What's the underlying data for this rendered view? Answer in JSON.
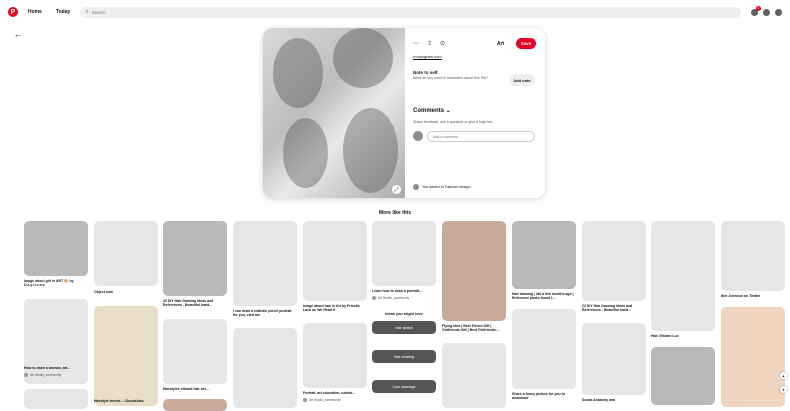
{
  "topbar": {
    "logo": "P",
    "home": "Home",
    "today": "Today",
    "search_placeholder": "Search",
    "notif_count": "1"
  },
  "pin": {
    "board": "Art",
    "save": "Save",
    "source": "hoopsgram.com",
    "note_title": "Note to self",
    "note_sub": "What do you want to remember about this Pin?",
    "add_note": "Add note",
    "comments": "Comments",
    "comments_sub": "Share feedback, ask a question or give a high five",
    "comment_placeholder": "Add a comment",
    "saved_text": "You saved to Fashion design"
  },
  "more_like_this": "More like this",
  "tiles": {
    "t1": "Image about girl in ART 🎨 by D.z.y.i.r.e.s.x",
    "t2": "Object note",
    "t3": "22 DIY Hair Drawing Ideas and References - Beautiful hand...",
    "t4": "I can draw a realistic pencil portrait for you, visit me",
    "t5": "Image about hair in Art by Priscila Lazo on We Heart It",
    "t6": "Learn how to draw a portrait...",
    "t6_by": "Art Studio_community",
    "t7": "Flying Idea | Best Friend Gift | Girlfriends Gift | Best Girlfriends...",
    "t8": "Hair drawing | idk a few months ago | Reference photo found i...",
    "t9": "22 DIY Hair Drawing Ideas and References - Beautiful hand...",
    "t10": "Hair. Eridani Lux",
    "t11": "Bee Johnson on Twitter",
    "t12": "How to draw a woman, art...",
    "t12_by": "Art Studio_community",
    "t13": "Hairstyles vibrant hair set...",
    "t14": "Portrait, art education, tutoria...",
    "t14_by": "Art Studio_community",
    "t15": "Share a funny picture for you to download",
    "t16": "Social Anatomy and",
    "t17": "Hairstyle trends -- Cloudsides"
  },
  "ideas": {
    "title": "Ideas you might love",
    "items": [
      "Hair sketch",
      "Hair drawing",
      "Cute drawings"
    ]
  },
  "colors": {
    "brand": "#e60023"
  }
}
